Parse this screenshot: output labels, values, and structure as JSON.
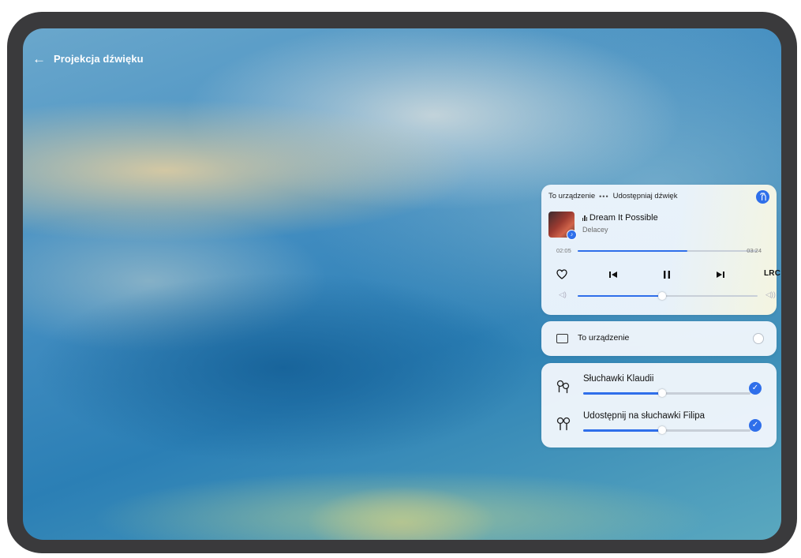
{
  "header": {
    "back_icon": "arrow-left-icon",
    "title": "Projekcja dźwięku"
  },
  "player": {
    "source_label": "To urządzenie",
    "separator": "•••",
    "share_label": "Udostępniaj dźwięk",
    "share_icon": "share-audio-icon",
    "song_title": "Dream It Possible",
    "artist": "Delacey",
    "elapsed": "02:05",
    "duration": "03:24",
    "progress_percent": 61,
    "volume_percent": 47,
    "lrc_label": "LRC",
    "icons": [
      "heart-icon",
      "previous-icon",
      "pause-icon",
      "next-icon",
      "volume-low-icon",
      "volume-high-icon"
    ]
  },
  "outputs": {
    "this_device_label": "To urządzenie",
    "this_device_selected": false,
    "headphones": [
      {
        "label": "Słuchawki Klaudii",
        "volume_percent": 47,
        "selected": true
      },
      {
        "label": "Udostępnij na słuchawki Filipa",
        "volume_percent": 47,
        "selected": true
      }
    ]
  },
  "colors": {
    "accent": "#2f6fea",
    "frame": "#3a3a3c",
    "card": "#eef4fa"
  }
}
